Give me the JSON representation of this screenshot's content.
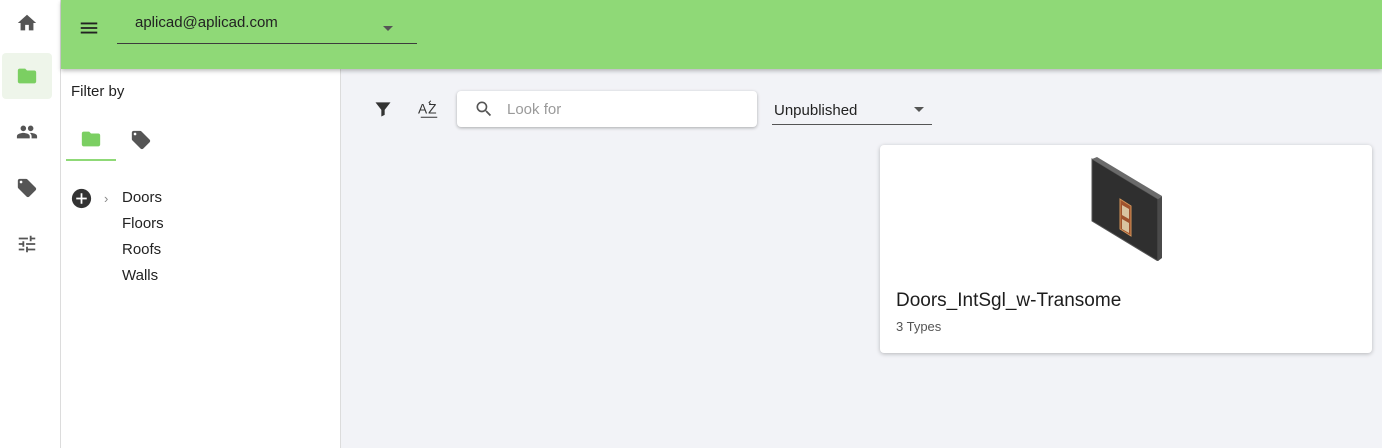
{
  "rail": {
    "items": [
      {
        "icon": "home-icon"
      },
      {
        "icon": "folder-icon",
        "active": true
      },
      {
        "icon": "people-icon"
      },
      {
        "icon": "tag-icon"
      },
      {
        "icon": "tune-icon"
      }
    ]
  },
  "topbar": {
    "account": "aplicad@aplicad.com",
    "color": "#8fd977"
  },
  "filter": {
    "title": "Filter by",
    "tabs": [
      {
        "icon": "folder-icon",
        "active": true
      },
      {
        "icon": "tag-icon"
      }
    ],
    "tree": [
      {
        "label": "Doors",
        "expandable": true
      },
      {
        "label": "Floors"
      },
      {
        "label": "Roofs"
      },
      {
        "label": "Walls"
      }
    ]
  },
  "toolbar": {
    "search_placeholder": "Look for",
    "search_value": "",
    "status": "Unpublished"
  },
  "cards": [
    {
      "title": "Doors_IntSgl_w-Transome",
      "subtitle": "3 Types"
    }
  ]
}
